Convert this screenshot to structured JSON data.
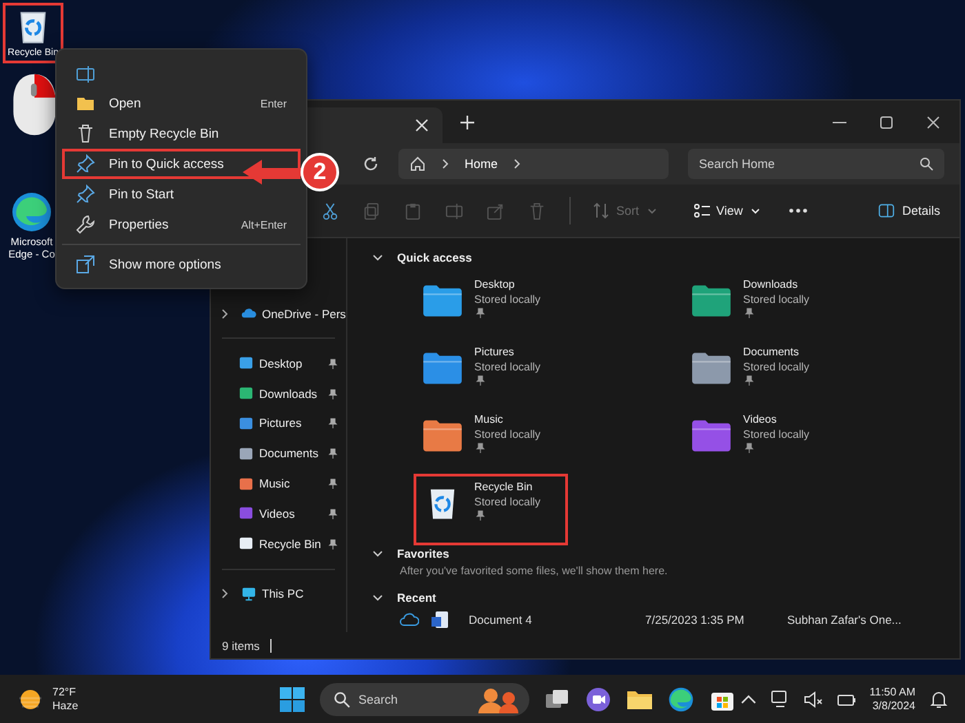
{
  "desktop_icons": [
    {
      "label": "Recycle Bin",
      "highlighted": true
    },
    {
      "label": "Microsoft Edge - Co",
      "highlighted": false
    }
  ],
  "context_menu": {
    "items": [
      {
        "kind": "action",
        "label": "Open",
        "shortcut": "Enter",
        "highlighted": false
      },
      {
        "kind": "action",
        "label": "Empty Recycle Bin",
        "highlighted": false
      },
      {
        "kind": "action",
        "label": "Pin to Quick access",
        "highlighted": true
      },
      {
        "kind": "action",
        "label": "Pin to Start",
        "highlighted": false
      },
      {
        "kind": "action",
        "label": "Properties",
        "shortcut": "Alt+Enter",
        "highlighted": false
      },
      {
        "kind": "more_options",
        "label": "Show more options",
        "highlighted": false
      }
    ]
  },
  "callout": {
    "number": "2"
  },
  "explorer": {
    "address": {
      "location": "Home"
    },
    "search": {
      "placeholder": "Search Home"
    },
    "toolbar": {
      "sort": {
        "label": "Sort",
        "disabled": true
      },
      "view": {
        "label": "View",
        "disabled": false
      },
      "details": {
        "label": "Details"
      }
    },
    "sidebar": {
      "top": [
        {
          "label": "OneDrive - Pers"
        }
      ],
      "pinned": [
        {
          "label": "Desktop"
        },
        {
          "label": "Downloads"
        },
        {
          "label": "Pictures"
        },
        {
          "label": "Documents"
        },
        {
          "label": "Music"
        },
        {
          "label": "Videos"
        },
        {
          "label": "Recycle Bin"
        }
      ],
      "bottom": [
        {
          "label": "This PC"
        }
      ]
    },
    "quick_access": {
      "title": "Quick access",
      "items": [
        {
          "name": "Desktop",
          "status": "Stored locally",
          "highlighted": false
        },
        {
          "name": "Downloads",
          "status": "Stored locally",
          "highlighted": false
        },
        {
          "name": "Pictures",
          "status": "Stored locally",
          "highlighted": false
        },
        {
          "name": "Documents",
          "status": "Stored locally",
          "highlighted": false
        },
        {
          "name": "Music",
          "status": "Stored locally",
          "highlighted": false
        },
        {
          "name": "Videos",
          "status": "Stored locally",
          "highlighted": false
        },
        {
          "name": "Recycle Bin",
          "status": "Stored locally",
          "highlighted": true
        }
      ]
    },
    "favorites": {
      "title": "Favorites",
      "empty_text": "After you've favorited some files, we'll show them here."
    },
    "recent": {
      "title": "Recent",
      "rows": [
        {
          "name": "Document 4",
          "date": "7/25/2023 1:35 PM",
          "location": "Subhan Zafar's One..."
        }
      ]
    },
    "status_bar": {
      "count": "9 items"
    }
  },
  "taskbar": {
    "weather": {
      "temperature": "72°F",
      "condition": "Haze"
    },
    "search": {
      "placeholder": "Search"
    },
    "clock": {
      "time": "11:50 AM",
      "date": "3/8/2024"
    }
  }
}
